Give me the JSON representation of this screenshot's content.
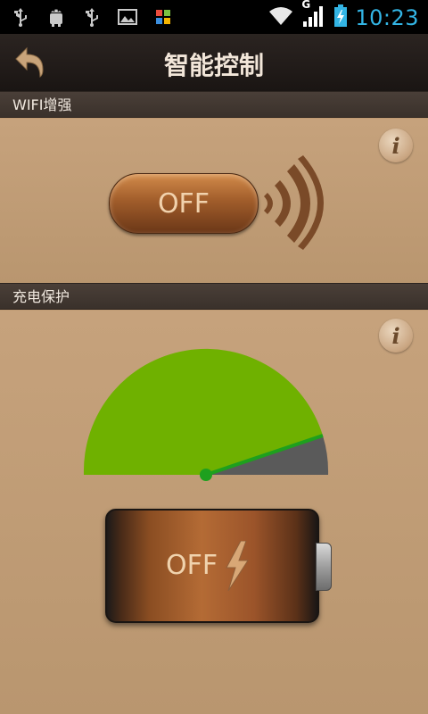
{
  "status_bar": {
    "time": "10:23",
    "left_icons": [
      "usb-icon",
      "android-icon",
      "usb-icon",
      "image-icon",
      "app-icon"
    ],
    "right_icons": [
      "wifi-signal-icon",
      "cellular-g-signal-icon",
      "battery-charging-icon"
    ],
    "network_type": "G"
  },
  "title_bar": {
    "title": "智能控制",
    "back_icon": "back-arrow-icon"
  },
  "wifi_section": {
    "header": "WIFI增强",
    "toggle_label": "OFF",
    "info_glyph": "i",
    "signal_icon": "wifi-waves-icon"
  },
  "charge_section": {
    "header": "充电保护",
    "info_glyph": "i",
    "gauge_icon": "charge-gauge-icon",
    "battery_label": "OFF",
    "battery_icon": "battery-icon",
    "lightning_icon": "lightning-icon"
  },
  "colors": {
    "status_bar_bg": "#000000",
    "clock": "#33b5e5",
    "title_bar_bg": "#1f1a17",
    "panel_bg": "#c09b74",
    "section_header_bg": "#3f3630",
    "gauge_green": "#6fb100",
    "gauge_needle": "#1ea01e",
    "gauge_gray": "#5a5a5a"
  }
}
